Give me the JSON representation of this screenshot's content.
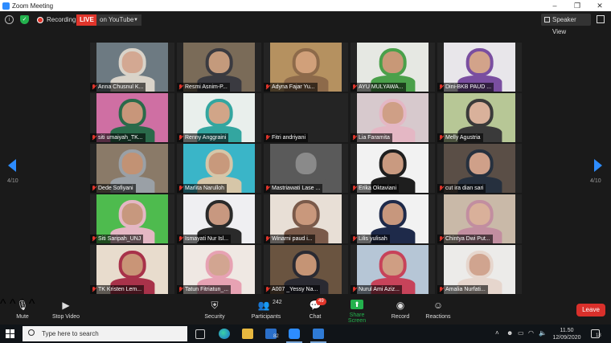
{
  "window": {
    "title": "Zoom Meeting"
  },
  "topbar": {
    "recording_label": "Recording",
    "live_label": "LIVE",
    "stream_label": "on YouTube",
    "speaker_view_label": "Speaker View"
  },
  "pager": {
    "left": "4/10",
    "right": "4/10"
  },
  "participants": [
    {
      "name": "Anna Chusnul K...",
      "bg": "#6d7a82",
      "skin": "#d3a892",
      "cloth": "#d9d3c9"
    },
    {
      "name": "Resmi Asnim-P...",
      "bg": "#7a6b58",
      "skin": "#c49a7c",
      "cloth": "#3a3a40"
    },
    {
      "name": "Adyna Fajar Yu...",
      "bg": "#b59160",
      "skin": "#d1a07a",
      "cloth": "#8d6a4a"
    },
    {
      "name": "AYU MULYAWA...",
      "bg": "#e6e8e3",
      "skin": "#c89877",
      "cloth": "#4aa04a"
    },
    {
      "name": "Dini-BKB PAUD ...",
      "bg": "#e8e6ea",
      "skin": "#d2a38a",
      "cloth": "#7a4ea0"
    },
    {
      "name": "siti umaiyah_TK...",
      "bg": "#cf6fa3",
      "skin": "#c8967a",
      "cloth": "#2a6a4a"
    },
    {
      "name": "Renny Anggraini",
      "bg": "#e9efec",
      "skin": "#d1a588",
      "cloth": "#33a6a0"
    },
    {
      "name": "Fitri andriyani",
      "bg": "#242424",
      "skin": "#242424",
      "cloth": "#242424"
    },
    {
      "name": "Lia Faramita",
      "bg": "#d7c9cd",
      "skin": "#cf9f86",
      "cloth": "#e4b7c4"
    },
    {
      "name": "Melly Agustria",
      "bg": "#b7c796",
      "skin": "#d9b19b",
      "cloth": "#3a3a3a"
    },
    {
      "name": "Dede Sofiyani",
      "bg": "#8a7a68",
      "skin": "#c29274",
      "cloth": "#9aa0a6"
    },
    {
      "name": "Marlita Narulloh",
      "bg": "#3ab5c8",
      "skin": "#c8997c",
      "cloth": "#d6c6a8"
    },
    {
      "name": "Mastriawati Lase ...",
      "bg": "#5a5a5a",
      "skin": "#8a8a8a",
      "cloth": "#5a5a5a"
    },
    {
      "name": "Erika Oktaviani",
      "bg": "#f2f2f2",
      "skin": "#c99a80",
      "cloth": "#1e1e1e"
    },
    {
      "name": "cut ira dian sari",
      "bg": "#5a4e46",
      "skin": "#cfa089",
      "cloth": "#26303e"
    },
    {
      "name": "Siti Saripah_UNJ",
      "bg": "#4ebb4e",
      "skin": "#c7987e",
      "cloth": "#e4b7c4"
    },
    {
      "name": "Ismayati Nur Isl...",
      "bg": "#efeff2",
      "skin": "#c89880",
      "cloth": "#2a2a2a"
    },
    {
      "name": "Winarni paud i...",
      "bg": "#e8dfd6",
      "skin": "#c9987c",
      "cloth": "#7a5a4a"
    },
    {
      "name": "Lilis yulisah",
      "bg": "#f2f2f2",
      "skin": "#c7977d",
      "cloth": "#1e2a4a"
    },
    {
      "name": "Chintya Dwi Put...",
      "bg": "#c9b9a8",
      "skin": "#d9b09a",
      "cloth": "#c28ea0"
    },
    {
      "name": "TK Kristen Lem...",
      "bg": "#e8dccd",
      "skin": "#c99577",
      "cloth": "#a8324a"
    },
    {
      "name": "Tatun Fitriatun_...",
      "bg": "#efe8e3",
      "skin": "#d2a591",
      "cloth": "#e7a2b3"
    },
    {
      "name": "A007 _Yessy Na...",
      "bg": "#6a5440",
      "skin": "#c59475",
      "cloth": "#2a2a32"
    },
    {
      "name": "Nurul Ami Aziz...",
      "bg": "#b6c6d6",
      "skin": "#cf9e83",
      "cloth": "#c7435a"
    },
    {
      "name": "Amalia Nurfati...",
      "bg": "#ecebe9",
      "skin": "#d0a48f",
      "cloth": "#e6d6cd"
    }
  ],
  "toolbar": {
    "mute": "Mute",
    "stop_video": "Stop Video",
    "security": "Security",
    "participants": "Participants",
    "participants_count": "242",
    "chat": "Chat",
    "chat_badge": "49",
    "share_screen": "Share Screen",
    "record": "Record",
    "reactions": "Reactions",
    "leave": "Leave"
  },
  "taskbar": {
    "search_placeholder": "Type here to search",
    "mail_badge": "82",
    "time": "11.50",
    "date": "12/09/2020",
    "notif_count": "18"
  },
  "colors": {
    "accent": "#2d8cff",
    "live_red": "#e0352b",
    "share_green": "#23b14d",
    "leave_red": "#d9302b"
  }
}
